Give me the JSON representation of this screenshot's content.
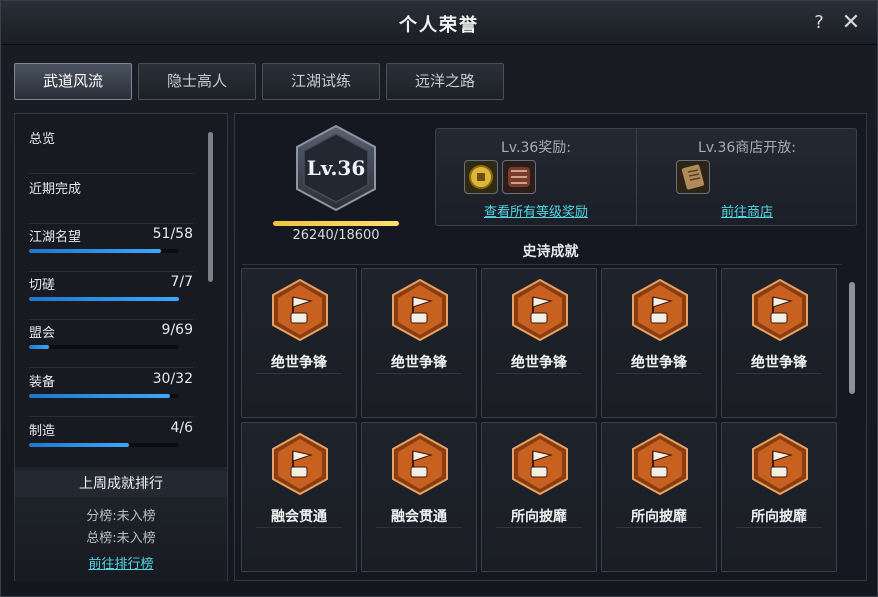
{
  "window": {
    "title": "个人荣誉",
    "help_label": "?",
    "close_label": "✕"
  },
  "tabs": [
    {
      "label": "武道风流",
      "active": true
    },
    {
      "label": "隐士高人",
      "active": false
    },
    {
      "label": "江湖试练",
      "active": false
    },
    {
      "label": "远洋之路",
      "active": false
    }
  ],
  "sidebar": {
    "items": [
      {
        "label": "总览"
      },
      {
        "label": "近期完成"
      },
      {
        "label": "江湖名望",
        "value": "51/58",
        "progress": 0.879
      },
      {
        "label": "切磋",
        "value": "7/7",
        "progress": 1.0
      },
      {
        "label": "盟会",
        "value": "9/69",
        "progress": 0.13
      },
      {
        "label": "装备",
        "value": "30/32",
        "progress": 0.9375
      },
      {
        "label": "制造",
        "value": "4/6",
        "progress": 0.667
      }
    ]
  },
  "ranking": {
    "title": "上周成就排行",
    "sub_rank": "分榜:未入榜",
    "total_rank": "总榜:未入榜",
    "link": "前往排行榜"
  },
  "level": {
    "label": "Lv.36",
    "exp_text": "26240/18600",
    "exp_progress": 1.0
  },
  "rewards": {
    "reward_title": "Lv.36奖励:",
    "reward_link": "查看所有等级奖励",
    "shop_title": "Lv.36商店开放:",
    "shop_link": "前往商店",
    "items": [
      {
        "icon": "gold-coin-icon"
      },
      {
        "icon": "armor-bracer-icon"
      },
      {
        "icon": "scroll-book-icon"
      }
    ]
  },
  "epic": {
    "title": "史诗成就",
    "cards": [
      {
        "name": "绝世争锋"
      },
      {
        "name": "绝世争锋"
      },
      {
        "name": "绝世争锋"
      },
      {
        "name": "绝世争锋"
      },
      {
        "name": "绝世争锋"
      },
      {
        "name": "融会贯通"
      },
      {
        "name": "融会贯通"
      },
      {
        "name": "所向披靡"
      },
      {
        "name": "所向披靡"
      },
      {
        "name": "所向披靡"
      }
    ]
  },
  "colors": {
    "accent_link": "#52d6e6",
    "progress_blue": "#3ea7ff",
    "exp_gold": "#f3c23c",
    "badge_orange": "#c8611f"
  }
}
